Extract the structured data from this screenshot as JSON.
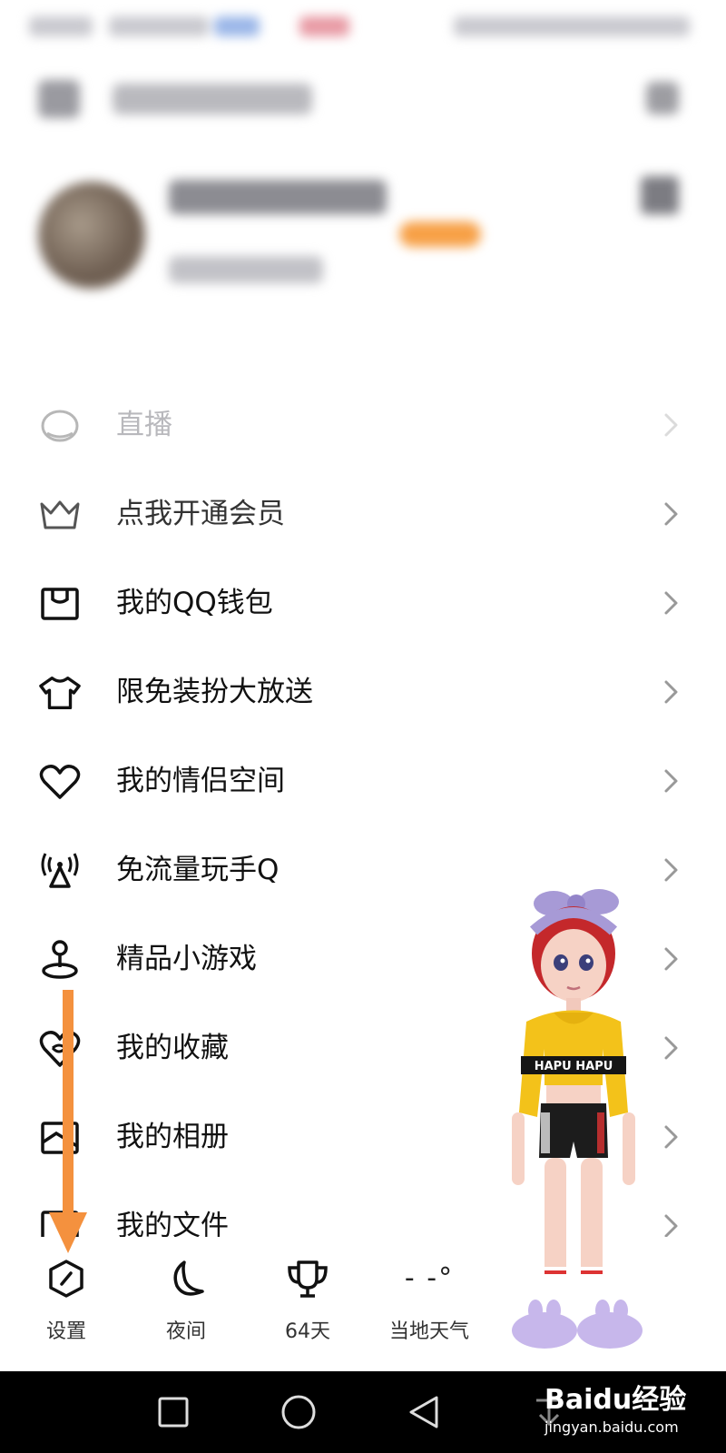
{
  "menu": {
    "items": [
      {
        "label": "直播"
      },
      {
        "label": "点我开通会员"
      },
      {
        "label": "我的QQ钱包"
      },
      {
        "label": "限免装扮大放送"
      },
      {
        "label": "我的情侣空间"
      },
      {
        "label": "免流量玩手Q"
      },
      {
        "label": "精品小游戏"
      },
      {
        "label": "我的收藏"
      },
      {
        "label": "我的相册"
      },
      {
        "label": "我的文件"
      }
    ]
  },
  "bottom_bar": {
    "settings_label": "设置",
    "night_label": "夜间",
    "days_label": "64天",
    "weather_value": "- -°",
    "weather_label": "当地天气"
  },
  "figure": {
    "shirt_text": "HAPU HAPU"
  },
  "watermark": {
    "main": "Baidu经验",
    "sub": "jingyan.baidu.com"
  },
  "colors": {
    "arrow": "#f4913e",
    "vip_tag": "#f7a046",
    "nav_bar": "#000000"
  }
}
